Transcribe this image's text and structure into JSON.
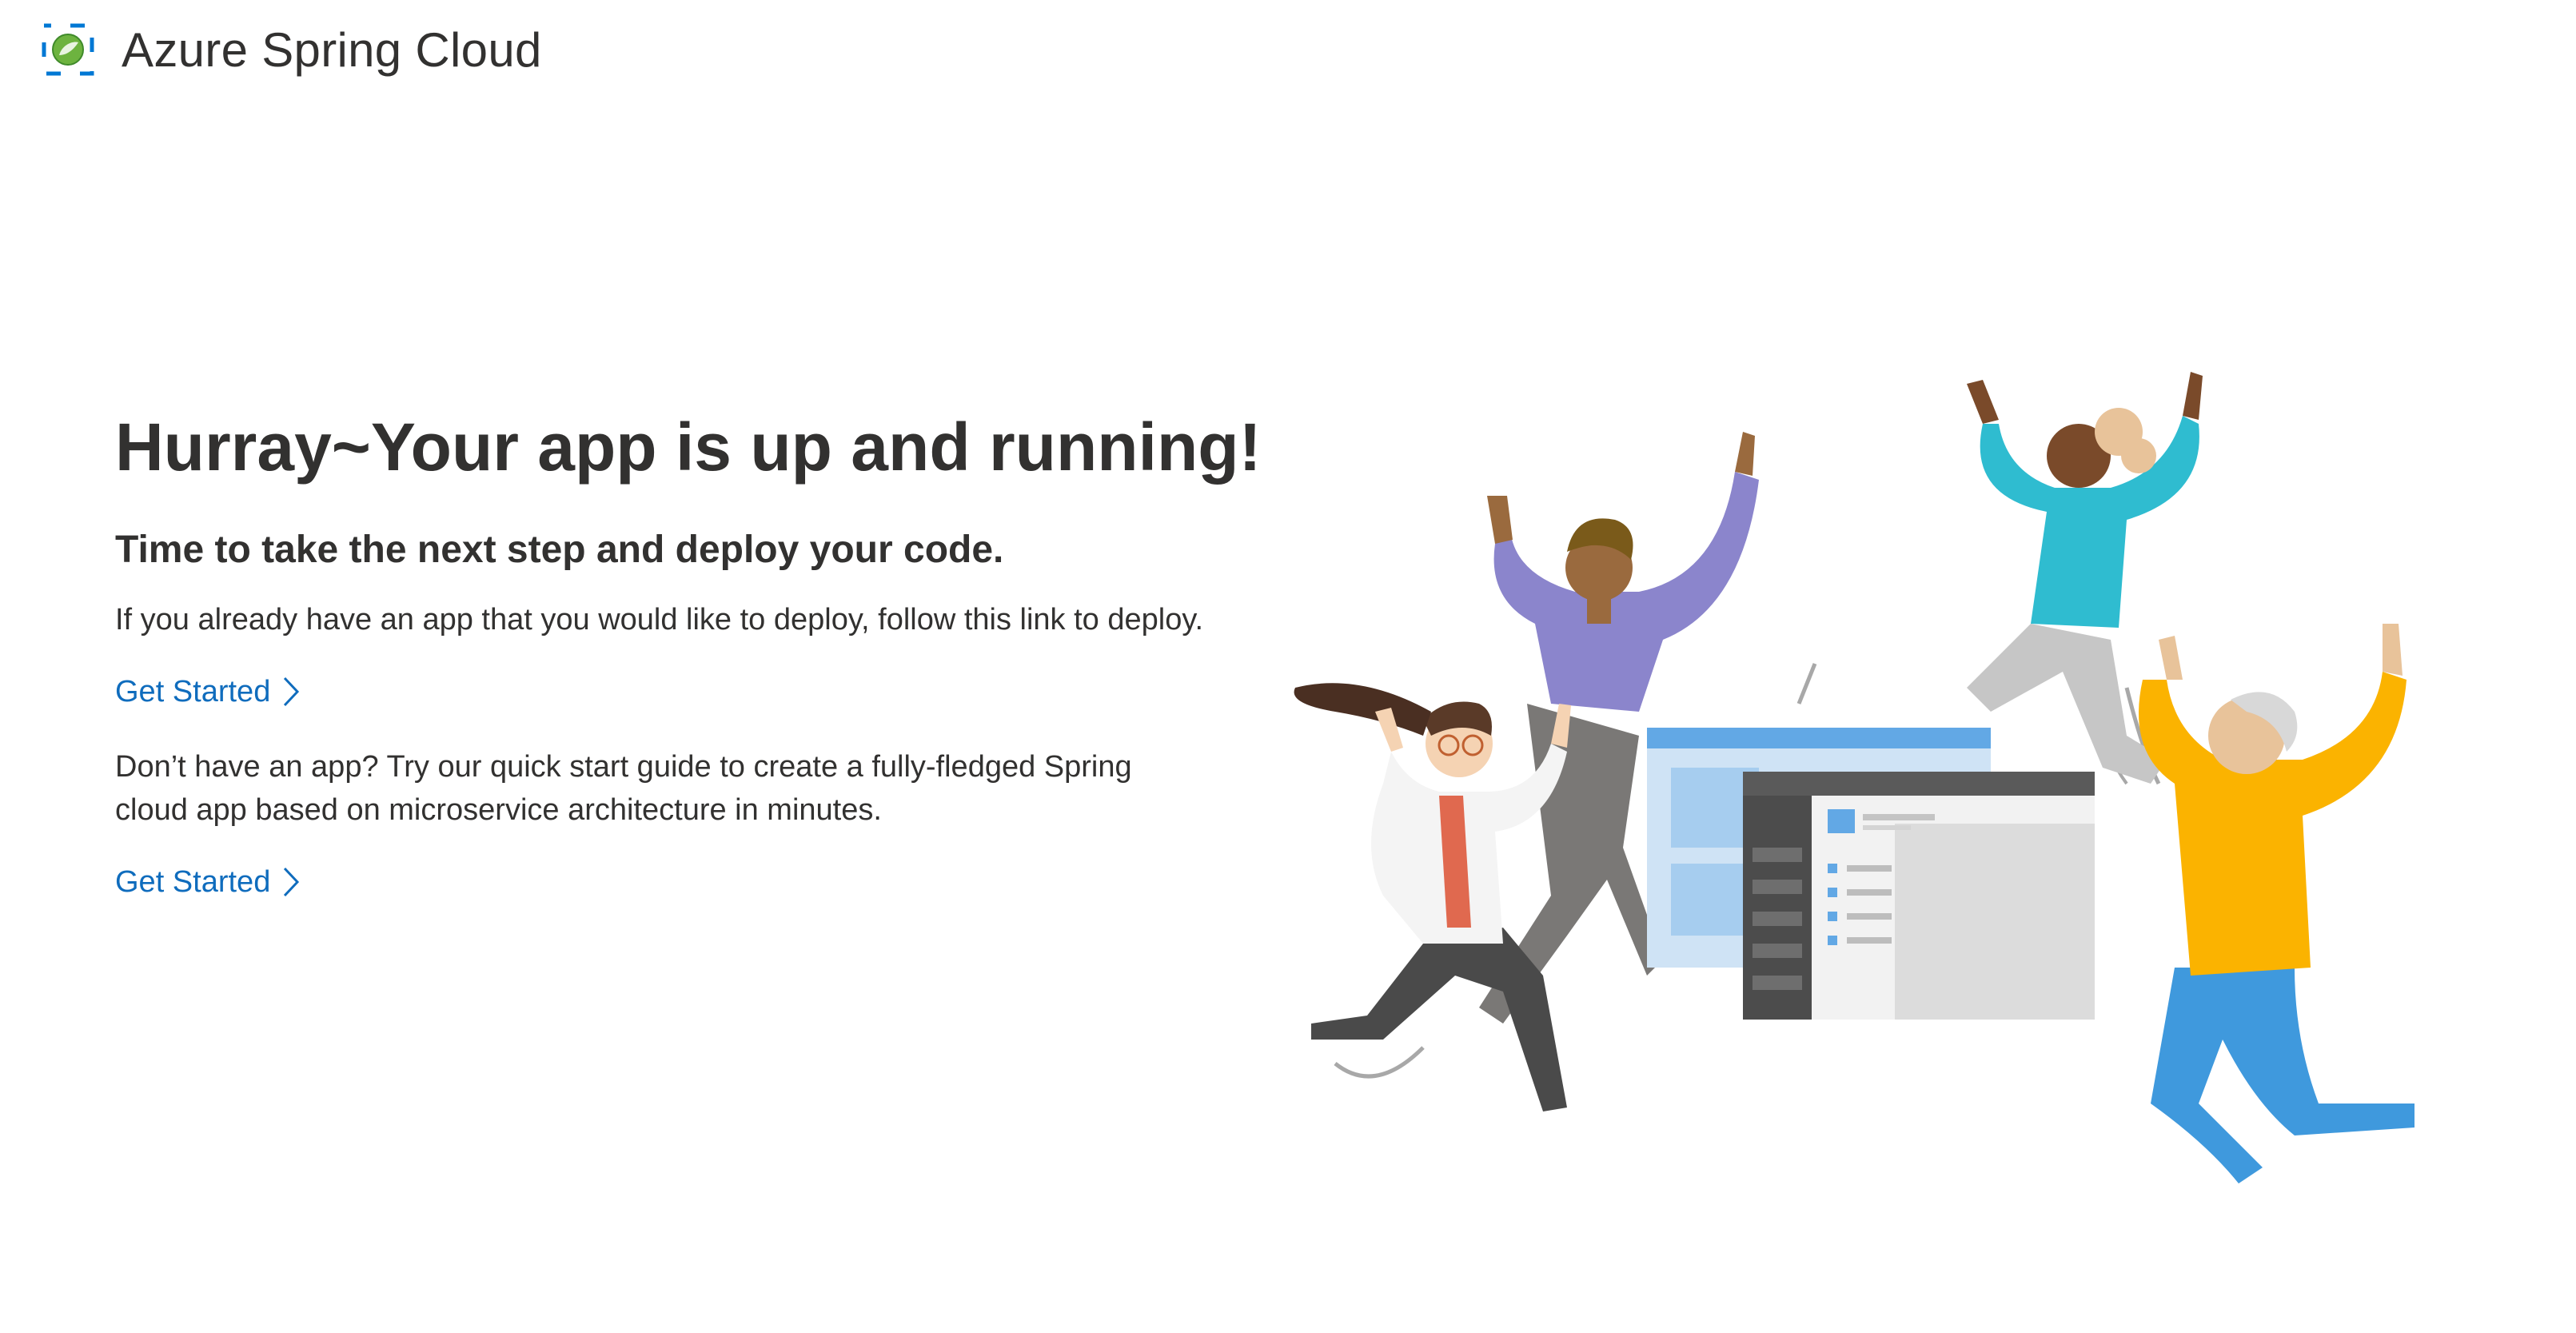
{
  "header": {
    "logo_icon": "azure-spring-cloud-logo",
    "title": "Azure Spring Cloud"
  },
  "main": {
    "headline": "Hurray~Your app is up and running!",
    "subheadline": "Time to take the next step and deploy your code.",
    "paragraph_1": "If you already have an app that you would like to deploy, follow this link to deploy.",
    "link_1": "Get Started",
    "paragraph_2": "Don’t have an app? Try our quick start guide to create a fully-fledged Spring cloud app based on microservice architecture in minutes.",
    "link_2": "Get Started",
    "link_icon": "chevron-right-icon"
  },
  "colors": {
    "link": "#0f6cbd",
    "text": "#323130",
    "logo_blue": "#0078d4",
    "logo_green": "#6db33f"
  }
}
